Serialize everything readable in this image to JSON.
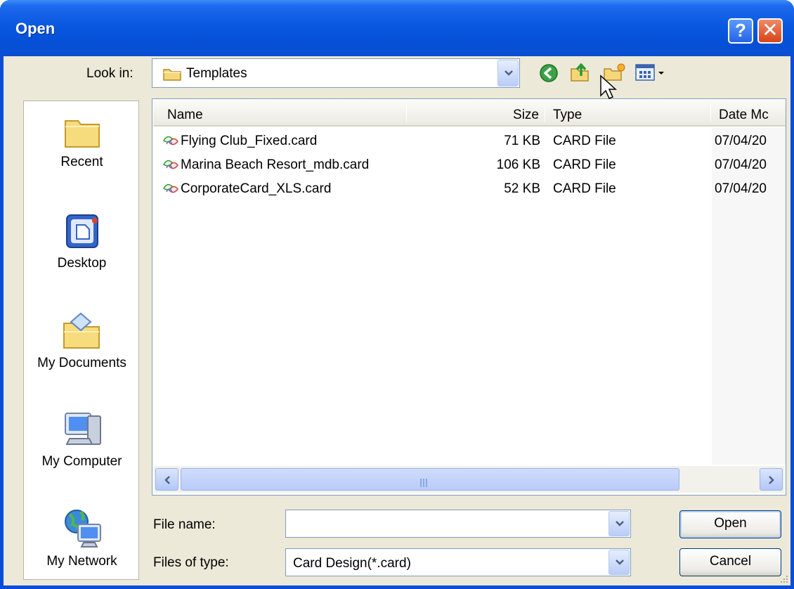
{
  "window": {
    "title": "Open",
    "help_label": "?",
    "close_label": "✕"
  },
  "look_in": {
    "label": "Look in:",
    "value": "Templates"
  },
  "toolbar": {
    "icons": [
      "back-icon",
      "up-folder-icon",
      "new-folder-icon",
      "views-menu-icon"
    ]
  },
  "places": [
    {
      "label": "Recent",
      "icon": "recent-icon"
    },
    {
      "label": "Desktop",
      "icon": "desktop-icon"
    },
    {
      "label": "My Documents",
      "icon": "my-documents-icon"
    },
    {
      "label": "My Computer",
      "icon": "my-computer-icon"
    },
    {
      "label": "My Network",
      "icon": "my-network-icon"
    }
  ],
  "file_list": {
    "columns": [
      "Name",
      "Size",
      "Type",
      "Date Mc"
    ],
    "rows": [
      {
        "name": "Flying Club_Fixed.card",
        "size": "71 KB",
        "type": "CARD File",
        "date": "07/04/20"
      },
      {
        "name": "Marina Beach Resort_mdb.card",
        "size": "106 KB",
        "type": "CARD File",
        "date": "07/04/20"
      },
      {
        "name": "CorporateCard_XLS.card",
        "size": "52 KB",
        "type": "CARD File",
        "date": "07/04/20"
      }
    ],
    "scroll_grip": "|||"
  },
  "file_name": {
    "label": "File name:",
    "value": ""
  },
  "file_type": {
    "label": "Files of type:",
    "value": "Card Design(*.card)"
  },
  "buttons": {
    "open": "Open",
    "cancel": "Cancel"
  },
  "colors": {
    "title_bar": "#0a58e0",
    "dialog_bg": "#ece9d8",
    "field_border": "#7f9db9"
  }
}
